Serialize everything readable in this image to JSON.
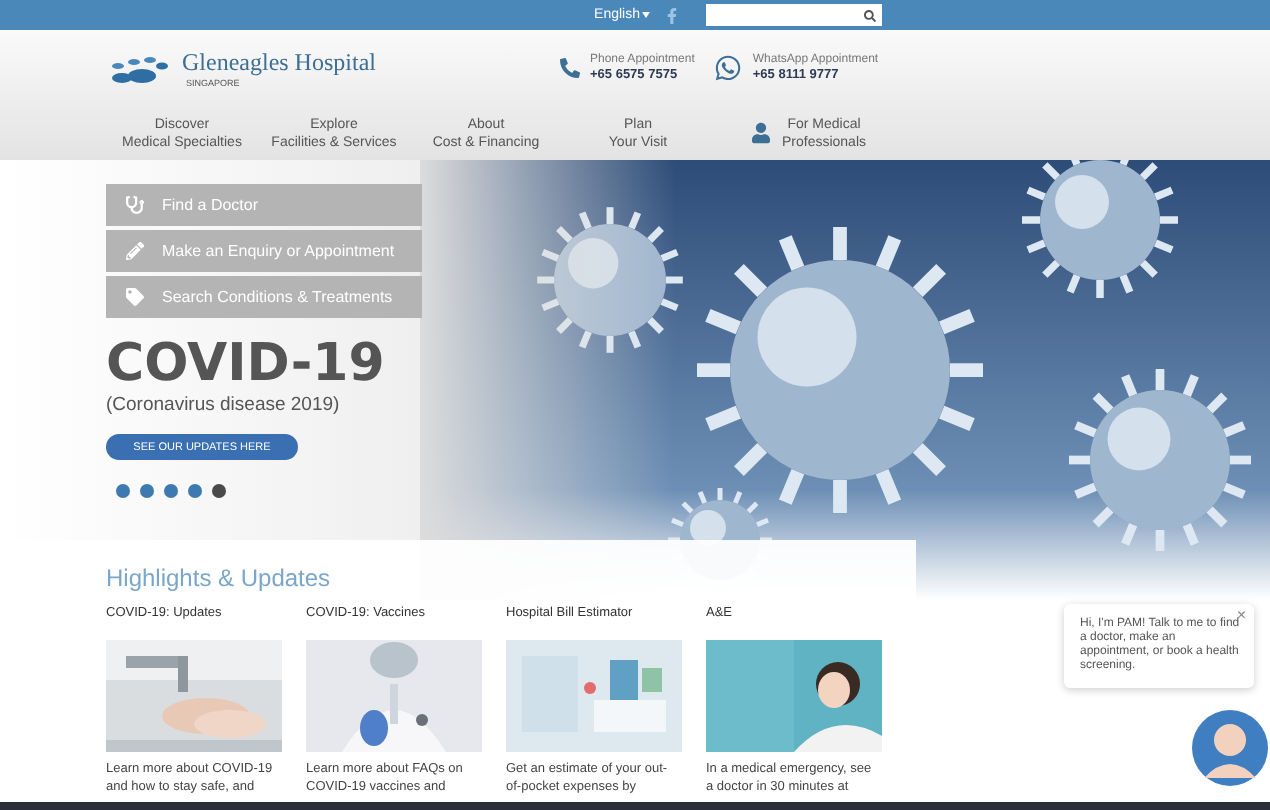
{
  "top_bar": {
    "language": "English"
  },
  "header": {
    "brand": {
      "name": "Gleneagles Hospital",
      "sub": "SINGAPORE"
    },
    "contacts": [
      {
        "kind": "phone",
        "label": "Phone Appointment",
        "number": "+65 6575 7575"
      },
      {
        "kind": "whatsapp",
        "label": "WhatsApp Appointment",
        "number": "+65 8111 9777"
      }
    ]
  },
  "nav": [
    {
      "lines": [
        "Discover",
        "Medical Specialties"
      ],
      "kind": "text"
    },
    {
      "lines": [
        "Explore",
        "Facilities & Services"
      ],
      "kind": "text"
    },
    {
      "lines": [
        "About",
        "Cost & Financing"
      ],
      "kind": "text"
    },
    {
      "lines": [
        "Plan",
        "Your Visit"
      ],
      "kind": "text"
    },
    {
      "lines": [
        "For Medical",
        "Professionals"
      ],
      "kind": "person"
    }
  ],
  "hero": {
    "actions": [
      {
        "kind": "stethoscope",
        "label": "Find a Doctor"
      },
      {
        "kind": "pencil",
        "label": "Make an Enquiry or Appointment"
      },
      {
        "kind": "tag",
        "label": "Search Conditions & Treatments"
      }
    ],
    "title": "COVID-19",
    "subtitle": "(Coronavirus disease 2019)",
    "cta": "SEE OUR UPDATES HERE",
    "dots": [
      {
        "selected": false
      },
      {
        "selected": false
      },
      {
        "selected": false
      },
      {
        "selected": false
      },
      {
        "selected": true
      }
    ]
  },
  "highlights": {
    "heading": "Highlights & Updates",
    "cards": [
      {
        "title": "COVID-19: Updates",
        "kind": "picture",
        "text": "Learn more about COVID-19 and how to stay safe, and"
      },
      {
        "title": "COVID-19: Vaccines",
        "kind": "picture",
        "text": "Learn more about FAQs on COVID-19 vaccines and"
      },
      {
        "title": "Hospital Bill Estimator",
        "kind": "picture",
        "text": "Get an estimate of your out-of-pocket expenses by"
      },
      {
        "title": "A&E",
        "kind": "picture",
        "text": "In a medical emergency, see a doctor in 30 minutes at"
      }
    ]
  },
  "chat": {
    "message": "Hi, I'm PAM! Talk to me to find a doctor, make an appointment, or book a health screening.",
    "close": "×"
  }
}
